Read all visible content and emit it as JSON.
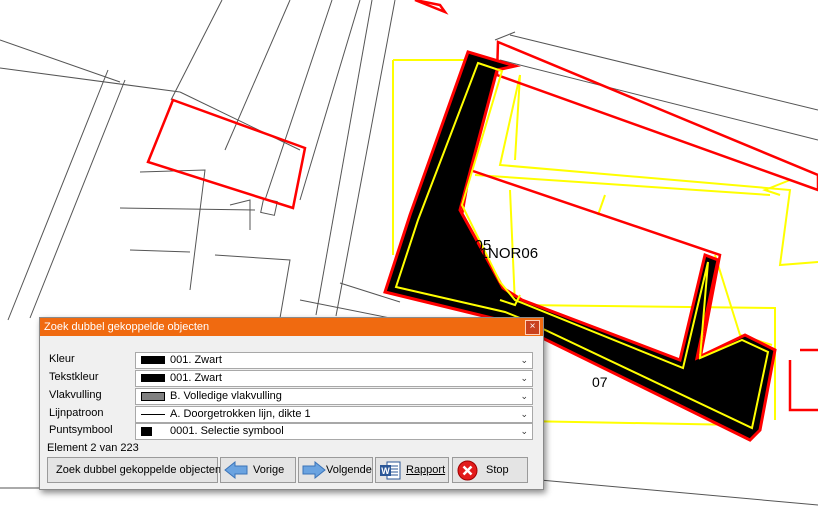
{
  "map": {
    "labels": [
      "OR05",
      "701NOR06",
      "07"
    ]
  },
  "dialog": {
    "title": "Zoek dubbel gekoppelde objecten",
    "close_glyph": "×",
    "fields": [
      {
        "label": "Kleur",
        "value": "001. Zwart",
        "swatch": "black"
      },
      {
        "label": "Tekstkleur",
        "value": "001. Zwart",
        "swatch": "black"
      },
      {
        "label": "Vlakvulling",
        "value": "B. Volledige vlakvulling",
        "swatch": "gray"
      },
      {
        "label": "Lijnpatroon",
        "value": "A. Doorgetrokken lijn, dikte 1",
        "swatch": "line"
      },
      {
        "label": "Puntsymbool",
        "value": "0001. Selectie symbool",
        "swatch": "square"
      }
    ],
    "status": "Element 2 van 223",
    "buttons": {
      "search": "Zoek dubbel gekoppelde objecten",
      "previous": "Vorige",
      "next": "Volgende",
      "report": "Rapport",
      "stop": "Stop"
    }
  },
  "icons": [
    "arrow-left-icon",
    "arrow-right-icon",
    "word-document-icon",
    "stop-icon",
    "chevron-down-icon"
  ],
  "colors": {
    "titlebar": "#f06a10",
    "building_fill": "#000000",
    "parcel_red": "#ff0000",
    "parcel_yellow": "#ffff00",
    "street_lines": "#555555"
  }
}
